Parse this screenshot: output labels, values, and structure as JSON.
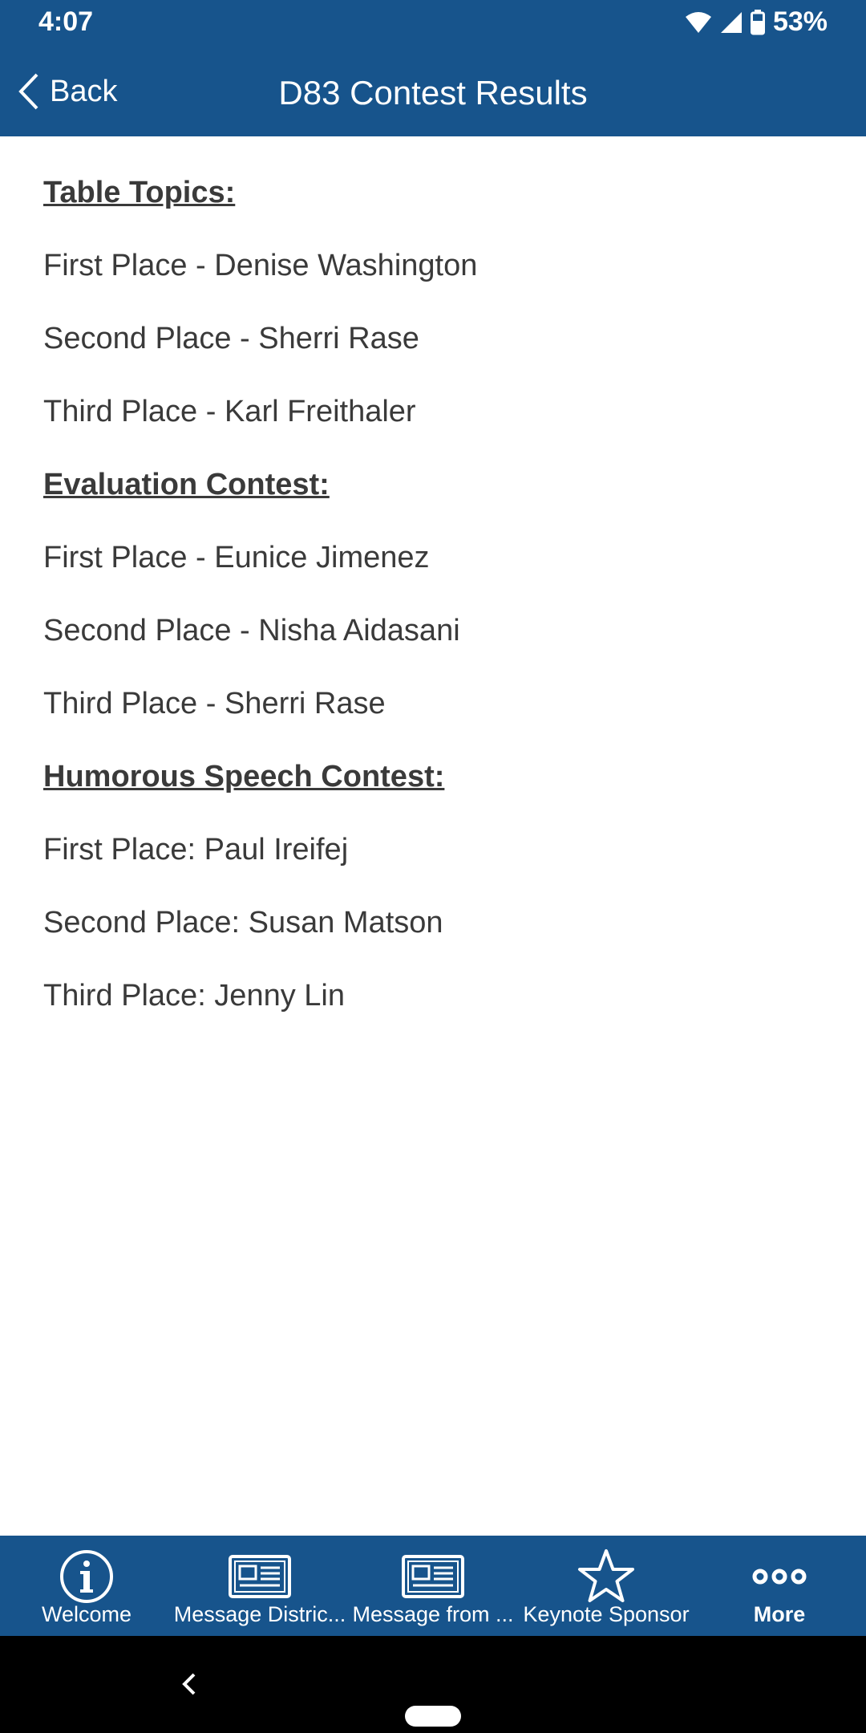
{
  "status_bar": {
    "time": "4:07",
    "battery": "53%"
  },
  "header": {
    "back_label": "Back",
    "title": "D83 Contest Results"
  },
  "sections": [
    {
      "heading": "Table Topics:",
      "results": [
        "First Place - Denise Washington",
        "Second Place - Sherri Rase",
        "Third Place - Karl Freithaler"
      ]
    },
    {
      "heading": "Evaluation Contest:",
      "results": [
        "First Place - Eunice Jimenez",
        "Second Place - Nisha Aidasani",
        "Third Place - Sherri Rase"
      ]
    },
    {
      "heading": "Humorous Speech Contest:",
      "results": [
        "First Place: Paul Ireifej",
        "Second Place: Susan Matson",
        "Third Place: Jenny Lin"
      ]
    }
  ],
  "bottom_nav": [
    {
      "label": "Welcome",
      "icon": "info-icon"
    },
    {
      "label": "Message Distric...",
      "icon": "newspaper-icon"
    },
    {
      "label": "Message from ...",
      "icon": "newspaper-icon"
    },
    {
      "label": "Keynote Sponsor",
      "icon": "star-icon"
    },
    {
      "label": "More",
      "icon": "more-dots-icon"
    }
  ],
  "colors": {
    "primary": "#17548c",
    "text": "#3a3a3a",
    "background": "#ffffff"
  }
}
